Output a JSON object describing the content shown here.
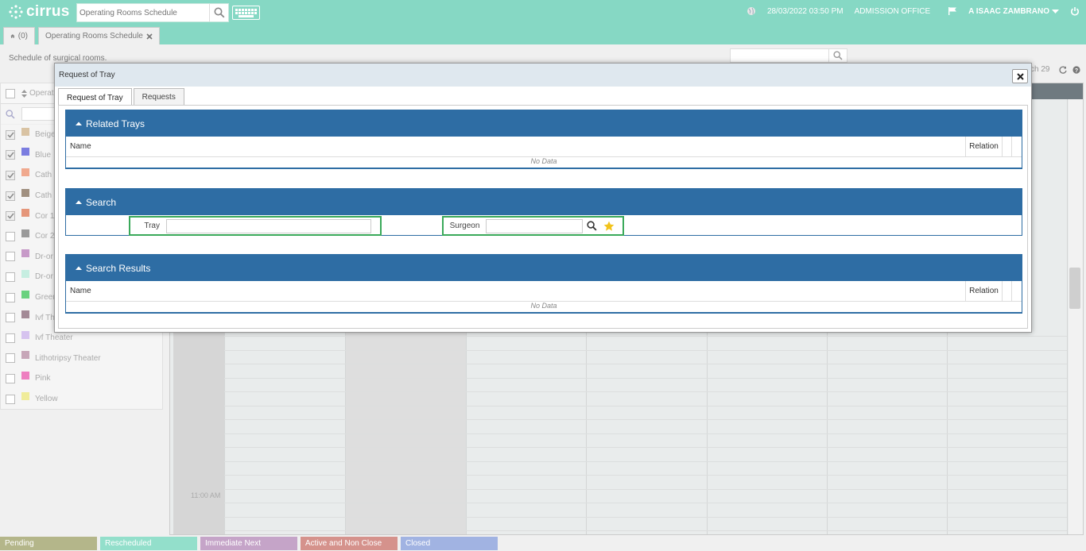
{
  "app": {
    "logo_text": "cirrus",
    "search_placeholder": "Operating Rooms Schedule",
    "datetime": "28/03/2022 03:50 PM",
    "department": "ADMISSION OFFICE",
    "user_name": "A ISAAC ZAMBRANO"
  },
  "tabs": {
    "home_count": "(0)",
    "active_tab_label": "Operating Rooms Schedule"
  },
  "page": {
    "subtitle": "Schedule of surgical rooms.",
    "date_fragment": "ch 29",
    "column_header": "Operati",
    "time_label": "11:00 AM"
  },
  "rooms": [
    {
      "name": "Beige",
      "checked": true,
      "color": "#d9c3a3"
    },
    {
      "name": "Blue",
      "checked": true,
      "color": "#7b7de0"
    },
    {
      "name": "Cath L",
      "checked": true,
      "color": "#f0a98e"
    },
    {
      "name": "Cath L",
      "checked": true,
      "color": "#a09080"
    },
    {
      "name": "Cor 1",
      "checked": true,
      "color": "#e5967a"
    },
    {
      "name": "Cor 2",
      "checked": false,
      "color": "#9a9a9a"
    },
    {
      "name": "Dr-or",
      "checked": false,
      "color": "#c79ac8"
    },
    {
      "name": "Dr-or",
      "checked": false,
      "color": "#c6eee1"
    },
    {
      "name": "Green",
      "checked": false,
      "color": "#6ad27f"
    },
    {
      "name": "Ivf The",
      "checked": false,
      "color": "#a38a96"
    },
    {
      "name": "Ivf Theater",
      "checked": false,
      "color": "#d6c3ef"
    },
    {
      "name": "Lithotripsy Theater",
      "checked": false,
      "color": "#c7a6b8"
    },
    {
      "name": "Pink",
      "checked": false,
      "color": "#ee7fc0"
    },
    {
      "name": "Yellow",
      "checked": false,
      "color": "#f0ec9a"
    }
  ],
  "legend": [
    {
      "label": "Pending",
      "color": "#b4b68a",
      "width": 122
    },
    {
      "label": "Rescheduled",
      "color": "#93dfcb",
      "width": 122
    },
    {
      "label": "Immediate Next",
      "color": "#c5a4c8",
      "width": 122
    },
    {
      "label": "Active and Non Close",
      "color": "#d5928c",
      "width": 122
    },
    {
      "label": "Closed",
      "color": "#a1b3e2",
      "width": 122
    }
  ],
  "modal": {
    "title": "Request of Tray",
    "tabs": [
      "Request of Tray",
      "Requests"
    ],
    "related_trays": {
      "title": "Related Trays",
      "col_name": "Name",
      "col_relation": "Relation",
      "empty": "No Data"
    },
    "search": {
      "title": "Search",
      "tray_label": "Tray",
      "tray_value": "",
      "surgeon_label": "Surgeon",
      "surgeon_value": ""
    },
    "search_results": {
      "title": "Search Results",
      "col_name": "Name",
      "col_relation": "Relation",
      "empty": "No Data"
    }
  },
  "colors": {
    "topbar": "#86d8c4",
    "panel_header": "#2e6da4",
    "highlight_border": "#3aa95a",
    "favorite_star": "#f2c31b"
  },
  "icons": [
    "cirrus-logo-icon",
    "search-icon",
    "keyboard-icon",
    "globe-icon",
    "flag-icon",
    "caret-down-icon",
    "power-icon",
    "home-icon",
    "close-icon",
    "sort-icon",
    "refresh-icon",
    "help-icon",
    "collapse-caret-icon",
    "star-icon"
  ]
}
